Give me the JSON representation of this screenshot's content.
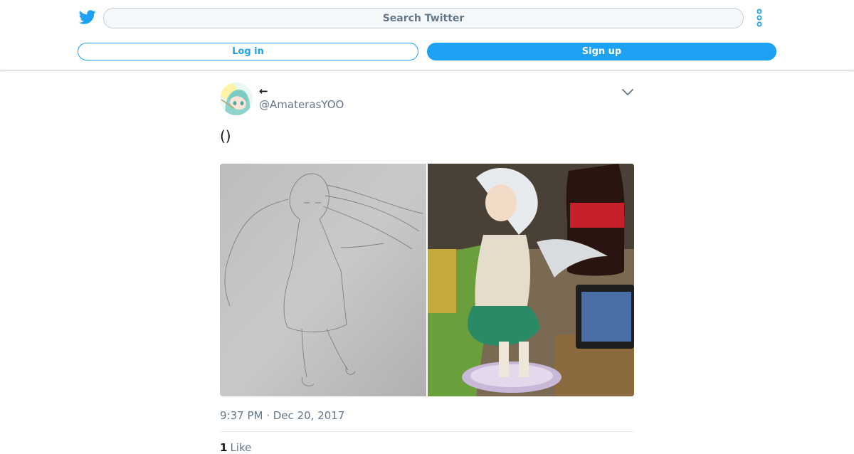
{
  "header": {
    "search_placeholder": "Search Twitter",
    "login_label": "Log in",
    "signup_label": "Sign up",
    "brand_color": "#1da1f2",
    "logo_icon": "twitter-bird-icon",
    "more_icon": "vertical-ellipsis-icon"
  },
  "tweet": {
    "display_name": "←",
    "handle": "@AmaterasYOO",
    "text": "()",
    "timestamp": "9:37 PM · Dec 20, 2017",
    "like_count": "1",
    "like_label": "Like",
    "media": [
      {
        "icon": "pencil-sketch-photo"
      },
      {
        "icon": "figure-photo"
      }
    ]
  }
}
